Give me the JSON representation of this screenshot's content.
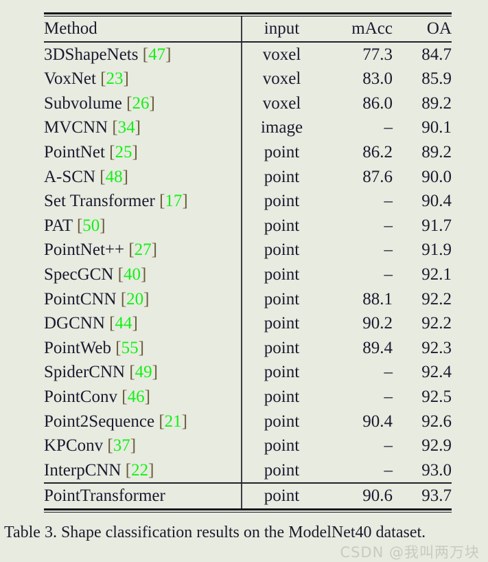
{
  "figure": {
    "caption": "Table 3. Shape classification results on the ModelNet40 dataset.",
    "watermark": "CSDN @我叫两万块"
  },
  "colors": {
    "page_background": "#e7ebe0",
    "text": "#1a1a2e",
    "citation_number": "#14f014",
    "citation_bracket": "#6a5a3a",
    "rule": "#15161c",
    "watermark": "#c6ccbe"
  },
  "table": {
    "columns": [
      {
        "key": "method",
        "label": "Method",
        "align": "left"
      },
      {
        "key": "input",
        "label": "input",
        "align": "center"
      },
      {
        "key": "macc",
        "label": "mAcc",
        "align": "right"
      },
      {
        "key": "oa",
        "label": "OA",
        "align": "right"
      }
    ],
    "rows": [
      {
        "method": "3DShapeNets",
        "cite": "47",
        "input": "voxel",
        "macc": "77.3",
        "oa": "84.7",
        "bold": false
      },
      {
        "method": "VoxNet",
        "cite": "23",
        "input": "voxel",
        "macc": "83.0",
        "oa": "85.9",
        "bold": false
      },
      {
        "method": "Subvolume",
        "cite": "26",
        "input": "voxel",
        "macc": "86.0",
        "oa": "89.2",
        "bold": false
      },
      {
        "method": "MVCNN",
        "cite": "34",
        "input": "image",
        "macc": "–",
        "oa": "90.1",
        "bold": false
      },
      {
        "method": "PointNet",
        "cite": "25",
        "input": "point",
        "macc": "86.2",
        "oa": "89.2",
        "bold": false
      },
      {
        "method": "A-SCN",
        "cite": "48",
        "input": "point",
        "macc": "87.6",
        "oa": "90.0",
        "bold": false
      },
      {
        "method": "Set Transformer",
        "cite": "17",
        "input": "point",
        "macc": "–",
        "oa": "90.4",
        "bold": false
      },
      {
        "method": "PAT",
        "cite": "50",
        "input": "point",
        "macc": "–",
        "oa": "91.7",
        "bold": false
      },
      {
        "method": "PointNet++",
        "cite": "27",
        "input": "point",
        "macc": "–",
        "oa": "91.9",
        "bold": false
      },
      {
        "method": "SpecGCN",
        "cite": "40",
        "input": "point",
        "macc": "–",
        "oa": "92.1",
        "bold": false
      },
      {
        "method": "PointCNN",
        "cite": "20",
        "input": "point",
        "macc": "88.1",
        "oa": "92.2",
        "bold": false
      },
      {
        "method": "DGCNN",
        "cite": "44",
        "input": "point",
        "macc": "90.2",
        "oa": "92.2",
        "bold": false
      },
      {
        "method": "PointWeb",
        "cite": "55",
        "input": "point",
        "macc": "89.4",
        "oa": "92.3",
        "bold": false
      },
      {
        "method": "SpiderCNN",
        "cite": "49",
        "input": "point",
        "macc": "–",
        "oa": "92.4",
        "bold": false
      },
      {
        "method": "PointConv",
        "cite": "46",
        "input": "point",
        "macc": "–",
        "oa": "92.5",
        "bold": false
      },
      {
        "method": "Point2Sequence",
        "cite": "21",
        "input": "point",
        "macc": "90.4",
        "oa": "92.6",
        "bold": false
      },
      {
        "method": "KPConv",
        "cite": "37",
        "input": "point",
        "macc": "–",
        "oa": "92.9",
        "bold": false
      },
      {
        "method": "InterpCNN",
        "cite": "22",
        "input": "point",
        "macc": "–",
        "oa": "93.0",
        "bold": false
      }
    ],
    "final_row": {
      "method": "PointTransformer",
      "cite": null,
      "input": "point",
      "macc": "90.6",
      "oa": "93.7",
      "bold": true
    }
  }
}
